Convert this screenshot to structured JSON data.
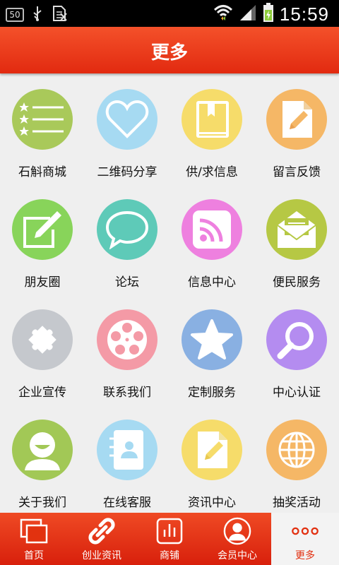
{
  "status_bar": {
    "badge": "50",
    "time": "15:59"
  },
  "header": {
    "title": "更多"
  },
  "grid": {
    "items": [
      {
        "label": "石斛商城",
        "icon": "list-stars-icon",
        "color": "#a9c95a"
      },
      {
        "label": "二维码分享",
        "icon": "heart-icon",
        "color": "#a6daf2"
      },
      {
        "label": "供/求信息",
        "icon": "book-icon",
        "color": "#f6dc6a"
      },
      {
        "label": "留言反馈",
        "icon": "note-edit-icon",
        "color": "#f5b766"
      },
      {
        "label": "朋友圈",
        "icon": "pencil-box-icon",
        "color": "#88d45a"
      },
      {
        "label": "论坛",
        "icon": "chat-bubble-icon",
        "color": "#5ecab8"
      },
      {
        "label": "信息中心",
        "icon": "rss-icon",
        "color": "#ee80df"
      },
      {
        "label": "便民服务",
        "icon": "envelope-icon",
        "color": "#b6c844"
      },
      {
        "label": "企业宣传",
        "icon": "puzzle-icon",
        "color": "#c5c8cd"
      },
      {
        "label": "联系我们",
        "icon": "film-reel-icon",
        "color": "#f49aa6"
      },
      {
        "label": "定制服务",
        "icon": "star-icon",
        "color": "#89b0e2"
      },
      {
        "label": "中心认证",
        "icon": "magnifier-icon",
        "color": "#b48cf0"
      },
      {
        "label": "关于我们",
        "icon": "smiley-user-icon",
        "color": "#a2c856"
      },
      {
        "label": "在线客服",
        "icon": "contact-book-icon",
        "color": "#a6daf2"
      },
      {
        "label": "资讯中心",
        "icon": "note-edit-icon",
        "color": "#f6dc6a"
      },
      {
        "label": "抽奖活动",
        "icon": "globe-icon",
        "color": "#f5b766"
      }
    ]
  },
  "tabbar": {
    "tabs": [
      {
        "label": "首页",
        "icon": "home-pages-icon"
      },
      {
        "label": "创业资讯",
        "icon": "link-icon"
      },
      {
        "label": "商铺",
        "icon": "chart-bars-icon"
      },
      {
        "label": "会员中心",
        "icon": "user-icon"
      },
      {
        "label": "更多",
        "icon": "more-dots-icon"
      }
    ],
    "active": "更多"
  }
}
